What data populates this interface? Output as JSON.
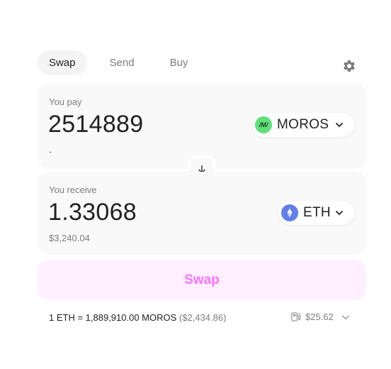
{
  "tabs": [
    {
      "label": "Swap",
      "active": true
    },
    {
      "label": "Send",
      "active": false
    },
    {
      "label": "Buy",
      "active": false
    }
  ],
  "settings_icon": "gear-icon",
  "pay": {
    "label": "You pay",
    "amount": "2514889",
    "fiat": "-",
    "token": {
      "symbol": "MOROS",
      "logo_text": "/M/",
      "logo_color": "#5fe07a"
    }
  },
  "receive": {
    "label": "You receive",
    "amount": "1.33068",
    "fiat": "$3,240.04",
    "token": {
      "symbol": "ETH",
      "logo_color": "#627eea"
    }
  },
  "swap_button": {
    "label": "Swap",
    "bg": "#ffefff",
    "color": "#fc72ff"
  },
  "rate": {
    "text": "1 ETH = 1,889,910.00 MOROS",
    "usd": "($2,434.86)"
  },
  "gas": {
    "value": "$25.62"
  }
}
